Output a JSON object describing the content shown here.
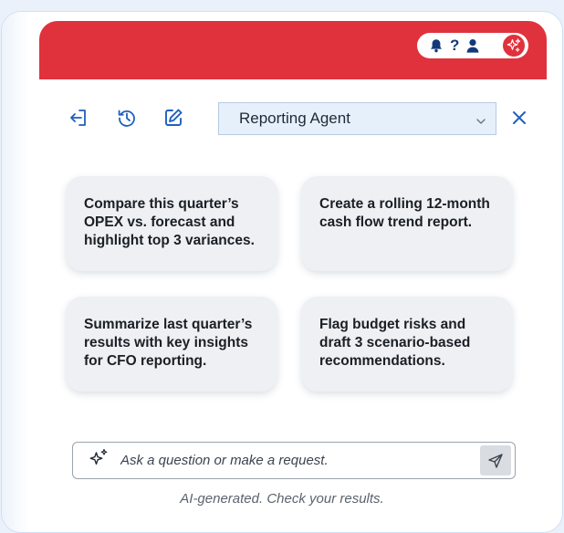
{
  "header": {
    "accent_color": "#e0323c",
    "icons": [
      "bell-icon",
      "help-icon",
      "user-icon",
      "ai-sparkle-icon"
    ],
    "help_label": "?"
  },
  "toolbar": {
    "icons": [
      "exit-icon",
      "history-icon",
      "new-chat-icon"
    ],
    "agent_select": {
      "value": "Reporting Agent"
    },
    "close_icon": "close-icon"
  },
  "suggestions": [
    "Compare this quarter’s OPEX vs. forecast and highlight top 3 variances.",
    "Create a rolling 12-month cash flow trend report.",
    "Summarize last quarter’s results with key insights for CFO reporting.",
    "Flag budget risks and draft 3 scenario-based recommendations."
  ],
  "composer": {
    "placeholder": "Ask a question or make a request.",
    "value": ""
  },
  "disclaimer": "AI-generated. Check your results."
}
